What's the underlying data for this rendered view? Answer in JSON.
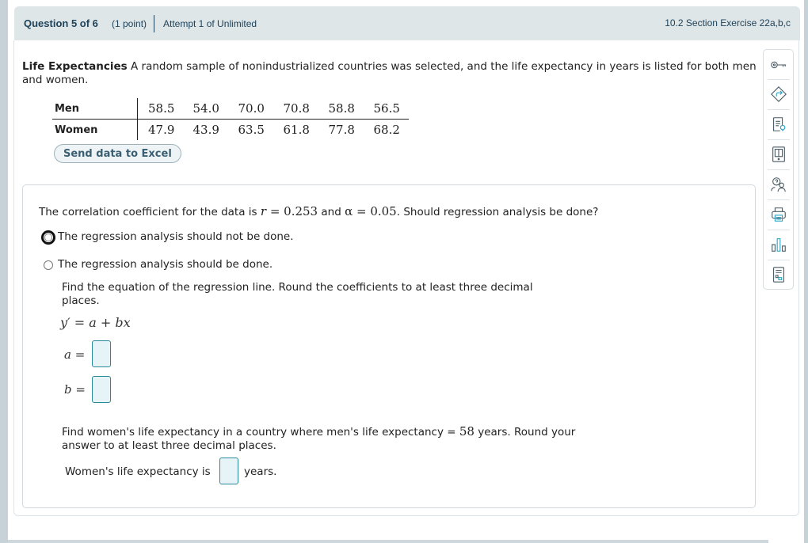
{
  "header": {
    "question": "Question 5 of 6",
    "points": "(1 point)",
    "attempt": "Attempt 1 of Unlimited",
    "section": "10.2 Section Exercise 22a,b,c"
  },
  "problem": {
    "title": "Life Expectancies",
    "intro": " A random sample of nonindustrialized countries was selected, and the life expectancy in years is listed for both men and women.",
    "table": {
      "rows": [
        {
          "label": "Men",
          "values": [
            "58.5",
            "54.0",
            "70.0",
            "70.8",
            "58.8",
            "56.5"
          ]
        },
        {
          "label": "Women",
          "values": [
            "47.9",
            "43.9",
            "63.5",
            "61.8",
            "77.8",
            "68.2"
          ]
        }
      ]
    },
    "excel_button": "Send data to Excel"
  },
  "question": {
    "prefix": "The correlation coefficient for the data is ",
    "r_sym": "r",
    "r_eq": " = 0.253",
    "and": " and ",
    "alpha_sym": "α",
    "alpha_eq": " = 0.05",
    "suffix": ". Should regression analysis be done?",
    "options": [
      {
        "label": "The regression analysis should not be done.",
        "selected": false,
        "focused": true
      },
      {
        "label": "The regression analysis should be done.",
        "selected": false,
        "focused": false
      }
    ],
    "regression_instruction": "Find the equation of the regression line. Round the coefficients to at least three decimal places.",
    "equation": "y′ = a + bx",
    "a_label": "a =",
    "b_label": "b =",
    "a_value": "",
    "b_value": "",
    "women_instruction_1": "Find women's life expectancy in a country where men's life expectancy = ",
    "women_instruction_num": "58",
    "women_instruction_2": " years. Round your answer to at least three decimal places.",
    "women_label": "Women's life expectancy is",
    "women_value": "",
    "women_unit": "years."
  },
  "toolbar": {
    "items": [
      {
        "icon": "key-icon"
      },
      {
        "icon": "direction-arrow-icon"
      },
      {
        "icon": "hint-document-icon"
      },
      {
        "icon": "ebook-icon"
      },
      {
        "icon": "ask-instructor-icon"
      },
      {
        "icon": "print-icon"
      },
      {
        "icon": "statistics-chart-icon"
      },
      {
        "icon": "calculator-document-icon"
      }
    ]
  },
  "colors": {
    "header_bg": "#dfe6e8",
    "header_text": "#20435a",
    "input_border": "#2a8a9a",
    "input_bg": "#e6f4f8",
    "icon_accent": "#2aa3c4"
  }
}
